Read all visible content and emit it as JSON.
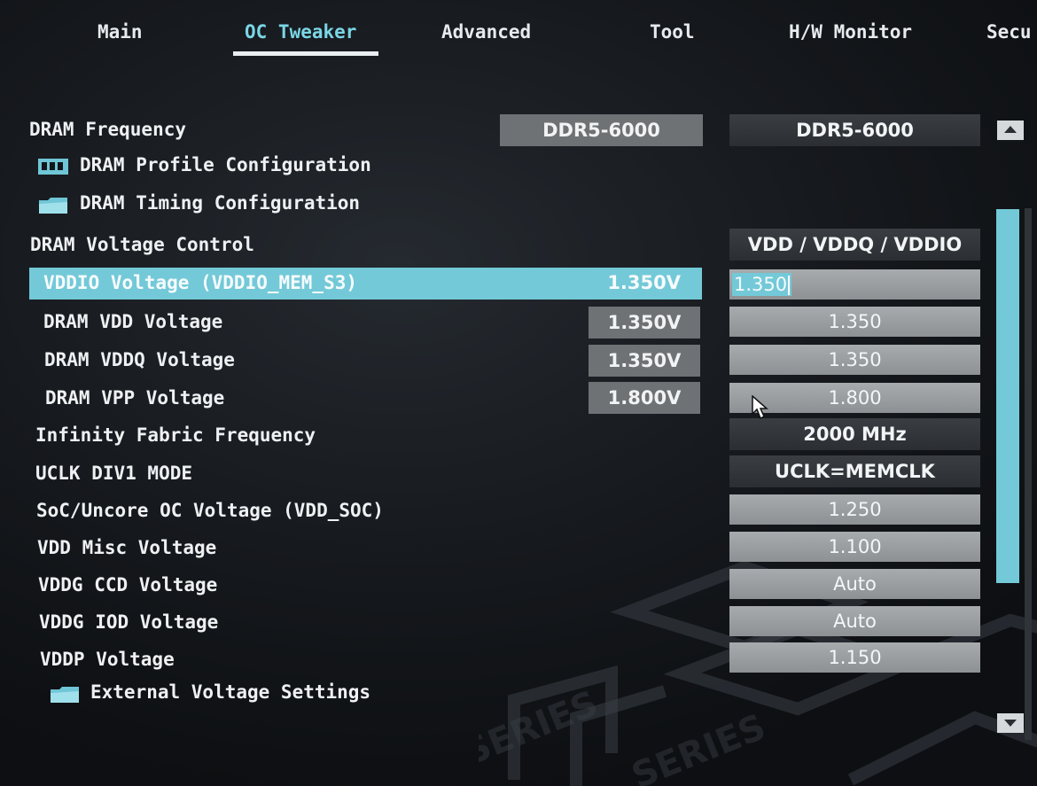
{
  "tabs": [
    {
      "label": "Main"
    },
    {
      "label": "OC Tweaker"
    },
    {
      "label": "Advanced"
    },
    {
      "label": "Tool"
    },
    {
      "label": "H/W Monitor"
    },
    {
      "label": "Secu"
    }
  ],
  "active_tab": "OC Tweaker",
  "dram_frequency": {
    "label": "DRAM Frequency",
    "current": "DDR5-6000",
    "setting": "DDR5-6000"
  },
  "dram_profile": {
    "label": "DRAM Profile Configuration",
    "icon": "memory-icon"
  },
  "dram_timing": {
    "label": "DRAM Timing Configuration",
    "icon": "folder-icon"
  },
  "dram_voltage_control": {
    "label": "DRAM Voltage Control",
    "setting": "VDD / VDDQ / VDDIO"
  },
  "vddio_voltage": {
    "label": "VDDIO Voltage (VDDIO_MEM_S3)",
    "current": "1.350V",
    "setting": "1.350"
  },
  "dram_vdd": {
    "label": "DRAM VDD Voltage",
    "current": "1.350V",
    "setting": "1.350"
  },
  "dram_vddq": {
    "label": "DRAM VDDQ Voltage",
    "current": "1.350V",
    "setting": "1.350"
  },
  "dram_vpp": {
    "label": "DRAM VPP Voltage",
    "current": "1.800V",
    "setting": "1.800"
  },
  "infinity_fabric": {
    "label": "Infinity Fabric Frequency",
    "setting": "2000 MHz"
  },
  "uclk_div1": {
    "label": "UCLK DIV1 MODE",
    "setting": "UCLK=MEMCLK"
  },
  "soc_voltage": {
    "label": "SoC/Uncore OC Voltage (VDD_SOC)",
    "setting": "1.250"
  },
  "vdd_misc": {
    "label": "VDD Misc Voltage",
    "setting": "1.100"
  },
  "vddg_ccd": {
    "label": "VDDG CCD Voltage",
    "setting": "Auto"
  },
  "vddg_iod": {
    "label": "VDDG IOD Voltage",
    "setting": "Auto"
  },
  "vddp": {
    "label": "VDDP Voltage",
    "setting": "1.150"
  },
  "external_voltage": {
    "label": "External Voltage Settings",
    "icon": "folder-icon"
  },
  "background_art": {
    "text1": "SERIES",
    "text2": "SERIES"
  },
  "colors": {
    "accent": "#73c9d8",
    "active_tab": "#7ad6e6",
    "current_box": "#6f7275"
  }
}
